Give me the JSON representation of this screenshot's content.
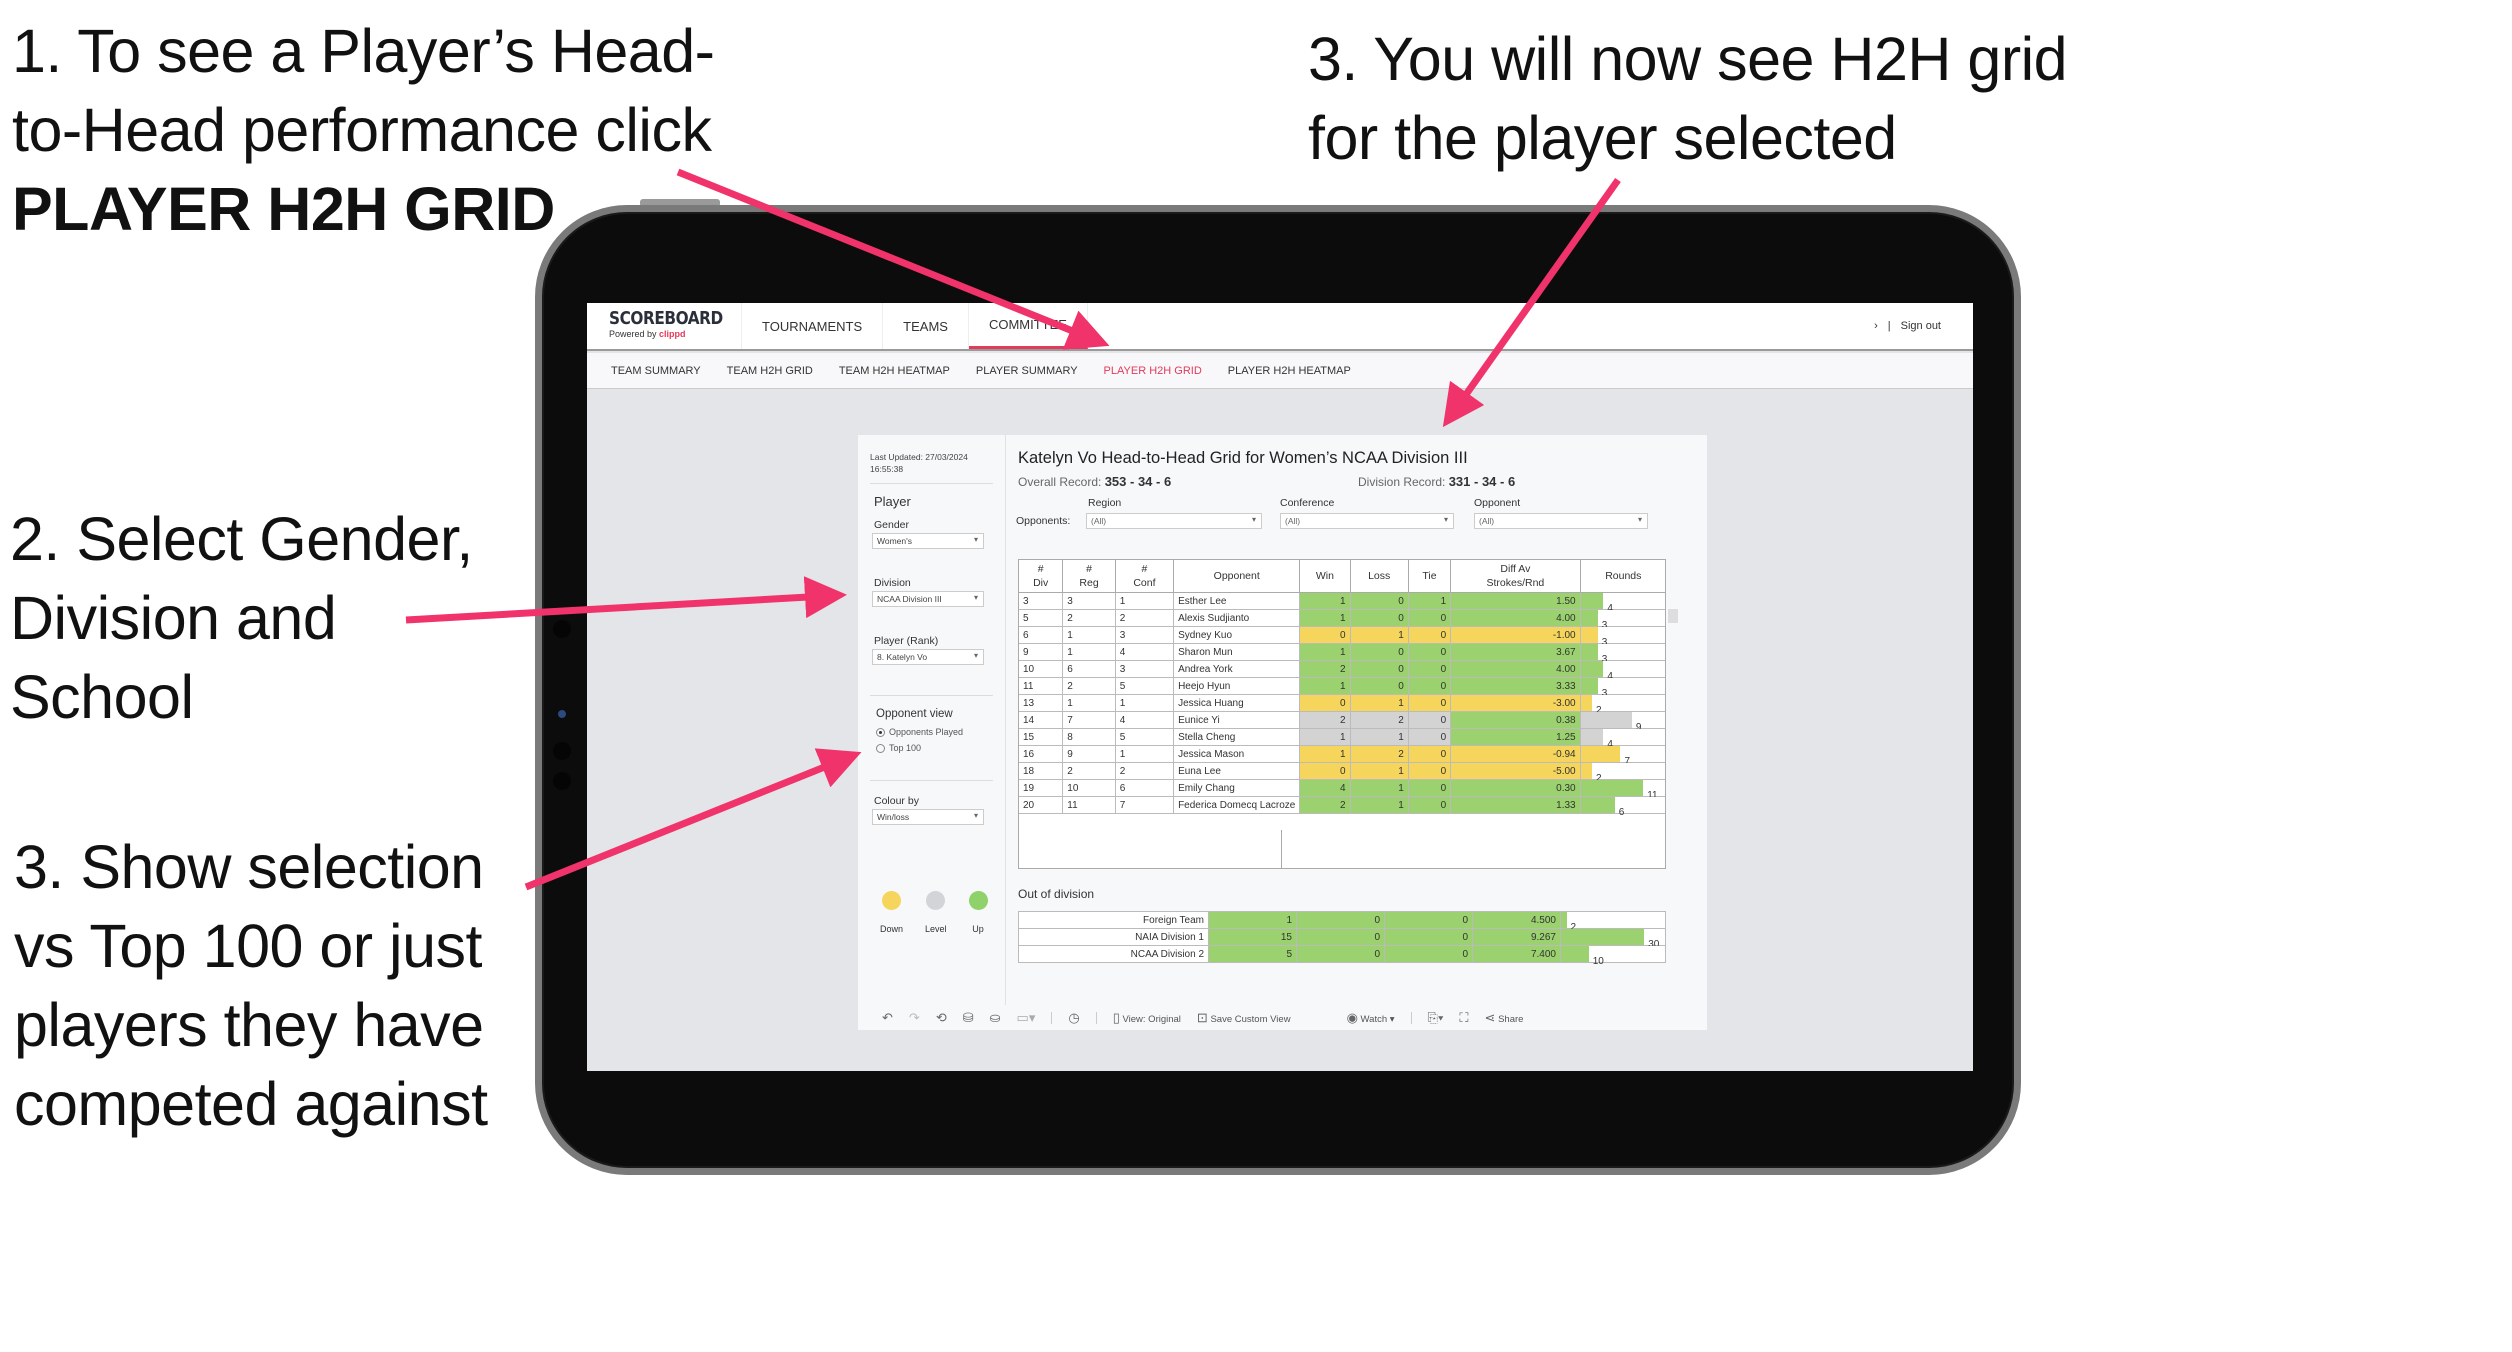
{
  "annotations": {
    "step1_line1": "1. To see a Player’s Head-",
    "step1_line2": "to-Head performance click",
    "step1_bold": "PLAYER H2H GRID",
    "step3a_line1": "3. You will now see H2H grid",
    "step3a_line2": "for the player selected",
    "step2_line1": "2. Select Gender,",
    "step2_line2": "Division and",
    "step2_line3": "School",
    "step3b_line1": "3. Show selection",
    "step3b_line2": "vs Top 100 or just",
    "step3b_line3": "players they have",
    "step3b_line4": "competed against",
    "arrow_color": "#f0336b"
  },
  "app": {
    "logo": "SCOREBOARD",
    "logo_sub_prefix": "Powered by ",
    "logo_sub_brand": "clippd",
    "accent": "#e23a5b",
    "topnav": [
      "TOURNAMENTS",
      "TEAMS",
      "COMMITTEE"
    ],
    "topnav_right_glyph": "›",
    "topnav_divider": "|",
    "sign_out": "Sign out",
    "subnav": [
      "TEAM SUMMARY",
      "TEAM H2H GRID",
      "TEAM H2H HEATMAP",
      "PLAYER SUMMARY",
      "PLAYER H2H GRID",
      "PLAYER H2H HEATMAP"
    ],
    "subnav_active": "PLAYER H2H GRID"
  },
  "sidebar": {
    "last_updated_label": "Last Updated: 27/03/2024",
    "last_updated_time": "16:55:38",
    "player_heading": "Player",
    "gender_label": "Gender",
    "gender_value": "Women's",
    "division_label": "Division",
    "division_value": "NCAA Division III",
    "player_label": "Player (Rank)",
    "player_value": "8. Katelyn Vo",
    "opponent_view_label": "Opponent view",
    "opponent_view_options": [
      "Opponents Played",
      "Top 100"
    ],
    "opponent_view_selected": "Opponents Played",
    "colour_by_label": "Colour by",
    "colour_by_value": "Win/loss",
    "legend": [
      {
        "label": "Down",
        "color": "#f6d55c"
      },
      {
        "label": "Level",
        "color": "#d3d4d8"
      },
      {
        "label": "Up",
        "color": "#8fd16a"
      }
    ]
  },
  "main": {
    "title": "Katelyn Vo Head-to-Head Grid for Women’s NCAA Division III",
    "overall_record_label": "Overall Record: ",
    "overall_record_value": "353 -  34 - 6",
    "division_record_label": "Division Record: ",
    "division_record_value": "331 -  34 - 6",
    "opponents_label": "Opponents:",
    "filters": [
      {
        "label": "Region",
        "value": "(All)"
      },
      {
        "label": "Conference",
        "value": "(All)"
      },
      {
        "label": "Opponent",
        "value": "(All)"
      }
    ],
    "columns": [
      "# Div",
      "# Reg",
      "# Conf",
      "Opponent",
      "Win",
      "Loss",
      "Tie",
      "Diff Av Strokes/Rnd",
      "Rounds"
    ],
    "column_lines": [
      [
        "#",
        "Div"
      ],
      [
        "#",
        "Reg"
      ],
      [
        "#",
        "Conf"
      ],
      [
        "Opponent"
      ],
      [
        "Win"
      ],
      [
        "Loss"
      ],
      [
        "Tie"
      ],
      [
        "Diff Av",
        "Strokes/Rnd"
      ],
      [
        "Rounds"
      ]
    ],
    "rows": [
      {
        "div": "3",
        "reg": "3",
        "conf": "1",
        "opponent": "Esther Lee",
        "win": "1",
        "loss": "0",
        "tie": "1",
        "diff": "1.50",
        "rounds": "4",
        "color": "g",
        "diff_color": "g"
      },
      {
        "div": "5",
        "reg": "2",
        "conf": "2",
        "opponent": "Alexis Sudjianto",
        "win": "1",
        "loss": "0",
        "tie": "0",
        "diff": "4.00",
        "rounds": "3",
        "color": "g",
        "diff_color": "g"
      },
      {
        "div": "6",
        "reg": "1",
        "conf": "3",
        "opponent": "Sydney Kuo",
        "win": "0",
        "loss": "1",
        "tie": "0",
        "diff": "-1.00",
        "rounds": "3",
        "color": "y",
        "diff_color": "y"
      },
      {
        "div": "9",
        "reg": "1",
        "conf": "4",
        "opponent": "Sharon Mun",
        "win": "1",
        "loss": "0",
        "tie": "0",
        "diff": "3.67",
        "rounds": "3",
        "color": "g",
        "diff_color": "g"
      },
      {
        "div": "10",
        "reg": "6",
        "conf": "3",
        "opponent": "Andrea York",
        "win": "2",
        "loss": "0",
        "tie": "0",
        "diff": "4.00",
        "rounds": "4",
        "color": "g",
        "diff_color": "g"
      },
      {
        "div": "11",
        "reg": "2",
        "conf": "5",
        "opponent": "Heejo Hyun",
        "win": "1",
        "loss": "0",
        "tie": "0",
        "diff": "3.33",
        "rounds": "3",
        "color": "g",
        "diff_color": "g"
      },
      {
        "div": "13",
        "reg": "1",
        "conf": "1",
        "opponent": "Jessica Huang",
        "win": "0",
        "loss": "1",
        "tie": "0",
        "diff": "-3.00",
        "rounds": "2",
        "color": "y",
        "diff_color": "y"
      },
      {
        "div": "14",
        "reg": "7",
        "conf": "4",
        "opponent": "Eunice Yi",
        "win": "2",
        "loss": "2",
        "tie": "0",
        "diff": "0.38",
        "rounds": "9",
        "color": "l",
        "diff_color": "g"
      },
      {
        "div": "15",
        "reg": "8",
        "conf": "5",
        "opponent": "Stella Cheng",
        "win": "1",
        "loss": "1",
        "tie": "0",
        "diff": "1.25",
        "rounds": "4",
        "color": "l",
        "diff_color": "g"
      },
      {
        "div": "16",
        "reg": "9",
        "conf": "1",
        "opponent": "Jessica Mason",
        "win": "1",
        "loss": "2",
        "tie": "0",
        "diff": "-0.94",
        "rounds": "7",
        "color": "y",
        "diff_color": "y"
      },
      {
        "div": "18",
        "reg": "2",
        "conf": "2",
        "opponent": "Euna Lee",
        "win": "0",
        "loss": "1",
        "tie": "0",
        "diff": "-5.00",
        "rounds": "2",
        "color": "y",
        "diff_color": "y"
      },
      {
        "div": "19",
        "reg": "10",
        "conf": "6",
        "opponent": "Emily Chang",
        "win": "4",
        "loss": "1",
        "tie": "0",
        "diff": "0.30",
        "rounds": "11",
        "color": "g",
        "diff_color": "g"
      },
      {
        "div": "20",
        "reg": "11",
        "conf": "7",
        "opponent": "Federica Domecq Lacroze",
        "win": "2",
        "loss": "1",
        "tie": "0",
        "diff": "1.33",
        "rounds": "6",
        "color": "g",
        "diff_color": "g"
      }
    ],
    "rounds_max": 30,
    "out_of_division_title": "Out of division",
    "out_of_division_rows": [
      {
        "label": "Foreign Team",
        "win": "1",
        "loss": "0",
        "tie": "0",
        "diff": "4.500",
        "rounds": "2"
      },
      {
        "label": "NAIA Division 1",
        "win": "15",
        "loss": "0",
        "tie": "0",
        "diff": "9.267",
        "rounds": "30"
      },
      {
        "label": "NCAA Division 2",
        "win": "5",
        "loss": "0",
        "tie": "0",
        "diff": "7.400",
        "rounds": "10"
      }
    ]
  },
  "toolbar": {
    "undo": "undo-icon",
    "redo": "redo-icon",
    "revert": "revert-icon",
    "view_original": "View: Original",
    "save_custom_view": "Save Custom View",
    "watch": "Watch",
    "share": "Share"
  }
}
